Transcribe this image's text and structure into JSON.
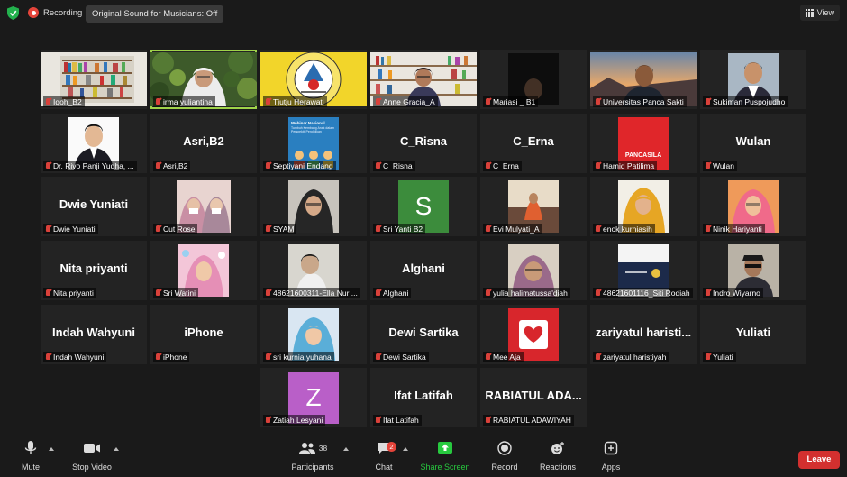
{
  "topbar": {
    "recording_label": "Recording",
    "original_sound_label": "Original Sound for Musicians: Off",
    "view_label": "View"
  },
  "participants": [
    {
      "name": "Iqoh_B2",
      "display": ""
    },
    {
      "name": "irma yuliantina",
      "display": ""
    },
    {
      "name": "Tjutju Herawati",
      "display": ""
    },
    {
      "name": "Anne Gracia_A",
      "display": ""
    },
    {
      "name": "Mariasi _ B1",
      "display": ""
    },
    {
      "name": "Universitas Panca Sakti",
      "display": ""
    },
    {
      "name": "Sukiman Puspojudho",
      "display": ""
    },
    {
      "name": "Dr. Rivo Panji Yudha, ...",
      "display": ""
    },
    {
      "name": "Asri,B2",
      "display": "Asri,B2"
    },
    {
      "name": "Septiyani Endang",
      "display": ""
    },
    {
      "name": "C_Risna",
      "display": "C_Risna"
    },
    {
      "name": "C_Erna",
      "display": "C_Erna"
    },
    {
      "name": "Hamid Patilima",
      "display": ""
    },
    {
      "name": "Wulan",
      "display": "Wulan"
    },
    {
      "name": "Dwie Yuniati",
      "display": "Dwie Yuniati"
    },
    {
      "name": "Cut Rose",
      "display": ""
    },
    {
      "name": "SYAM",
      "display": ""
    },
    {
      "name": "Sri Yanti B2",
      "display": ""
    },
    {
      "name": "Evi Mulyati_A",
      "display": ""
    },
    {
      "name": "enok kurniasih",
      "display": ""
    },
    {
      "name": "Ninik Hariyanti",
      "display": ""
    },
    {
      "name": "Nita priyanti",
      "display": "Nita priyanti"
    },
    {
      "name": "Sri Watini",
      "display": ""
    },
    {
      "name": "48621600311-Ella Nur ...",
      "display": ""
    },
    {
      "name": "Alghani",
      "display": "Alghani"
    },
    {
      "name": "yulia halimatussa'diah",
      "display": ""
    },
    {
      "name": "48621601116_Siti Rodiah",
      "display": ""
    },
    {
      "name": "Indro Wiyarno",
      "display": ""
    },
    {
      "name": "Indah Wahyuni",
      "display": "Indah Wahyuni"
    },
    {
      "name": "iPhone",
      "display": "iPhone"
    },
    {
      "name": "sri kurnia yuhana",
      "display": ""
    },
    {
      "name": "Dewi Sartika",
      "display": "Dewi Sartika"
    },
    {
      "name": "Mee Aja",
      "display": ""
    },
    {
      "name": "zariyatul haristiyah",
      "display": "zariyatul haristi..."
    },
    {
      "name": "Yuliati",
      "display": "Yuliati"
    },
    {
      "name": "Zatiah Lesyani",
      "display": ""
    },
    {
      "name": "Ifat Latifah",
      "display": "Ifat Latifah"
    },
    {
      "name": "RABIATUL ADAWIYAH",
      "display": "RABIATUL ADA..."
    }
  ],
  "tile_text": {
    "s_letter": "S",
    "z_letter": "Z",
    "pancasila": "PANCASILA",
    "webinar_title": "Webinar Nasional",
    "webinar_sub": "Tumbuh Kembang Anak dalam Perspektif Pendidikan",
    "logo_ring": "UNIVERSITAS PANCA SAKTI BEKASI"
  },
  "toolbar": {
    "mute": "Mute",
    "stop_video": "Stop Video",
    "participants": "Participants",
    "participant_count": "38",
    "chat": "Chat",
    "chat_badge": "2",
    "share_screen": "Share Screen",
    "record": "Record",
    "reactions": "Reactions",
    "apps": "Apps",
    "leave": "Leave"
  }
}
